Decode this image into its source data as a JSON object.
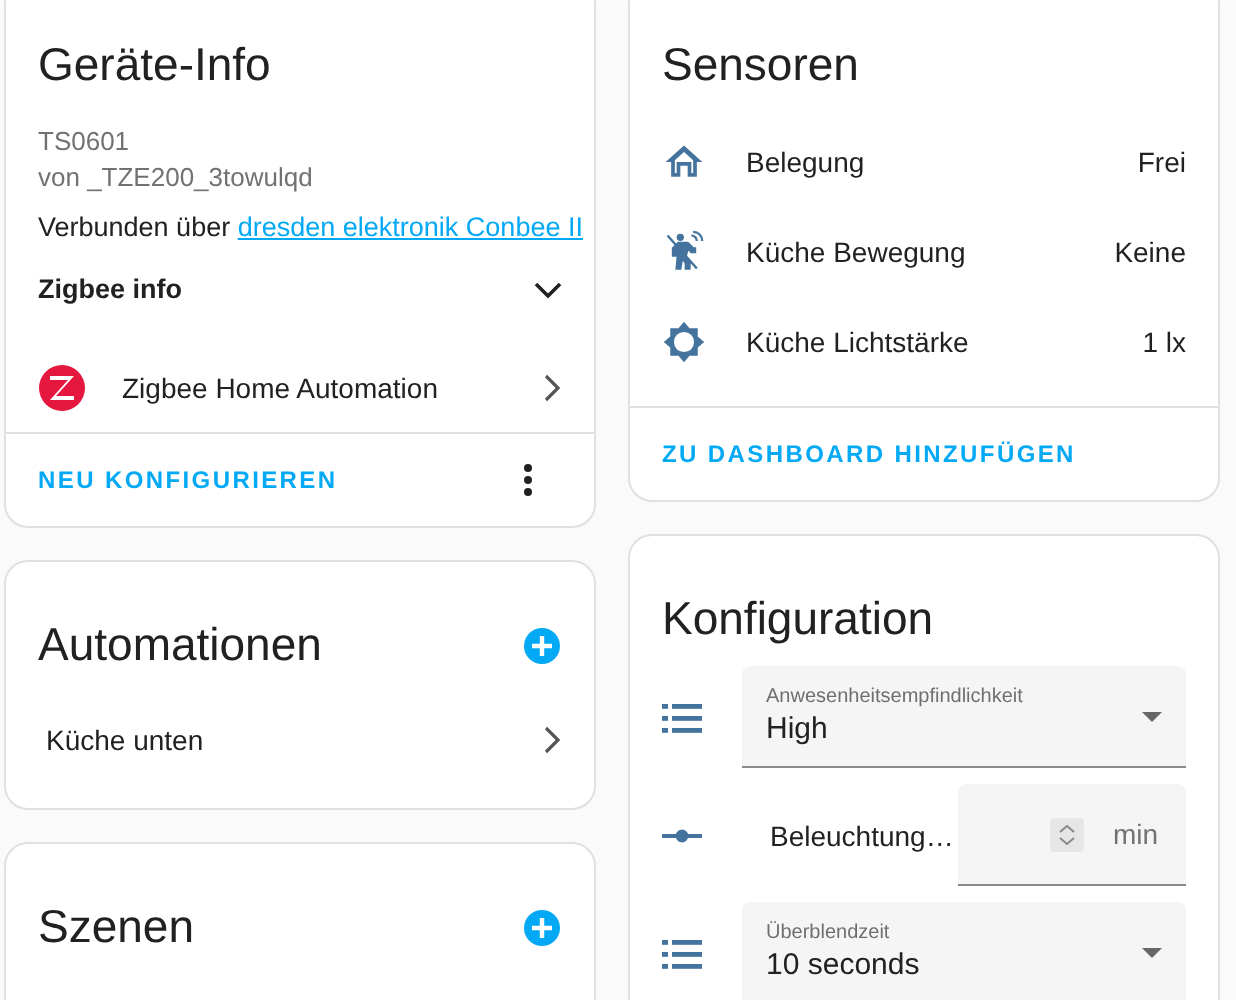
{
  "device_info": {
    "title": "Geräte-Info",
    "model": "TS0601",
    "manufacturer": "von _TZE200_3towulqd",
    "connected_label": "Verbunden über",
    "connected_link": "dresden elektronik Conbee II",
    "zigbee_info": {
      "label": "Zigbee info",
      "expanded": false
    },
    "integration": "Zigbee Home Automation",
    "action": "NEU KONFIGURIEREN"
  },
  "automations": {
    "title": "Automationen",
    "items": [
      "Küche unten"
    ]
  },
  "scenes": {
    "title": "Szenen"
  },
  "sensors": {
    "title": "Sensoren",
    "items": [
      {
        "name": "Belegung",
        "state": "Frei"
      },
      {
        "name": "Küche Bewegung",
        "state": "Keine"
      },
      {
        "name": "Küche Lichtstärke",
        "state": "1 lx"
      }
    ],
    "action": "ZU DASHBOARD HINZUFÜGEN"
  },
  "configuration": {
    "title": "Konfiguration",
    "items": [
      {
        "kind": "select",
        "label": "Anwesenheitsempfindlichkeit",
        "value": "High"
      },
      {
        "kind": "number",
        "label": "Beleuchtung…",
        "unit": "min"
      },
      {
        "kind": "select",
        "label": "Überblendzeit",
        "value": "10 seconds"
      }
    ]
  }
}
